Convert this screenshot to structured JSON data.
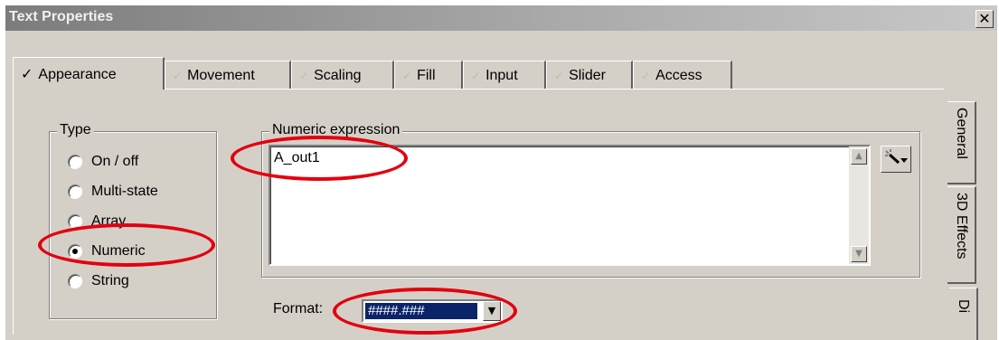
{
  "dialog": {
    "title": "Text Properties",
    "close_glyph": "✕"
  },
  "tabs": [
    {
      "label": "Appearance",
      "active": true
    },
    {
      "label": "Movement"
    },
    {
      "label": "Scaling"
    },
    {
      "label": "Fill"
    },
    {
      "label": "Input"
    },
    {
      "label": "Slider"
    },
    {
      "label": "Access"
    }
  ],
  "side_tabs": [
    {
      "label": "General"
    },
    {
      "label": "3D Effects"
    },
    {
      "label": "Di"
    }
  ],
  "type_group": {
    "title": "Type",
    "options": [
      {
        "label": "On / off",
        "selected": false
      },
      {
        "label": "Multi-state",
        "selected": false
      },
      {
        "label": "Array",
        "selected": false
      },
      {
        "label": "Numeric",
        "selected": true
      },
      {
        "label": "String",
        "selected": false
      }
    ]
  },
  "expression_group": {
    "title": "Numeric expression",
    "value": "A_out1",
    "wand_icon": "magic-wand-icon"
  },
  "format": {
    "label": "Format:",
    "value": "####.###"
  },
  "annotation_color": "#e3000f"
}
